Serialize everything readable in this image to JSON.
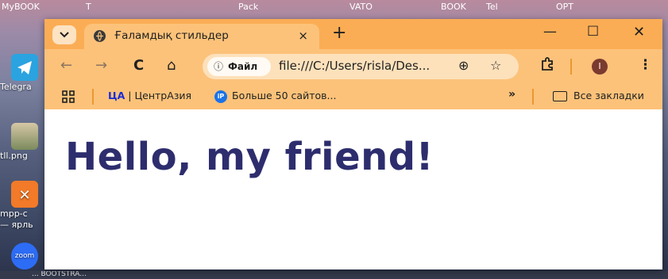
{
  "desktop": {
    "top_text": [
      "MyBOOK",
      "T",
      "Pack",
      "VATO",
      "BOOK",
      "Tel",
      "OPT"
    ],
    "icons": [
      {
        "name": "telegram",
        "label": "Telegra"
      },
      {
        "name": "image",
        "label": "tll.png"
      },
      {
        "name": "xampp",
        "label": "mpp-c"
      },
      {
        "name": "xampp-shortcut",
        "label": "— ярль"
      },
      {
        "name": "zoom",
        "label": "zoom"
      }
    ],
    "bottom_text": "... BOOTSTRA..."
  },
  "browser": {
    "tab": {
      "title": "Ғаламдық стильдер",
      "close": "×"
    },
    "tab_switch_icon": "chevron-down-icon",
    "new_tab": "+",
    "window_controls": {
      "minimize": "—",
      "maximize": "☐",
      "close": "✕"
    },
    "nav": {
      "back": "←",
      "forward": "→",
      "reload": "C",
      "home": "⌂"
    },
    "omnibox": {
      "chip_icon": "ⓘ",
      "chip_label": "Файл",
      "url": "file:///C:/Users/risla/Des...",
      "zoom_icon": "⊕",
      "star_icon": "☆"
    },
    "extensions_icon": "puzzle-icon",
    "profile_initial": "I",
    "menu_icon": "⋮",
    "bookmarks": {
      "apps_icon": "apps-grid-icon",
      "items": [
        {
          "badge": "ЦА",
          "label": " | ЦентрАзия"
        },
        {
          "badge": "iP",
          "label": "Больше 50 сайтов..."
        }
      ],
      "overflow": "»",
      "all_bookmarks": "Все закладки"
    },
    "accent_color": "#fbad55",
    "toolbar_color": "#fcc27a"
  },
  "page": {
    "heading": "Hello, my friend!",
    "heading_color": "#2d2d6e"
  }
}
